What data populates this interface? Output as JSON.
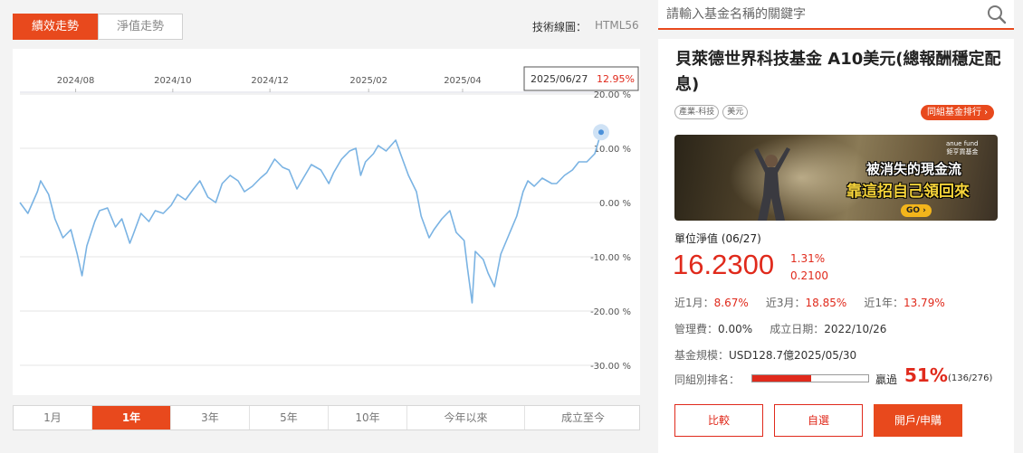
{
  "tabs": {
    "performance": "績效走勢",
    "nav": "淨值走勢"
  },
  "tech": {
    "label": "技術線圖：",
    "value": "HTML56"
  },
  "tooltip": {
    "date": "2025/06/27",
    "value": "12.95%"
  },
  "ranges": [
    "1月",
    "1年",
    "3年",
    "5年",
    "10年",
    "今年以來",
    "成立至今"
  ],
  "active_range": "1年",
  "search": {
    "placeholder": "請輸入基金名稱的關鍵字"
  },
  "fund": {
    "title": "貝萊德世界科技基金 A10美元(總報酬穩定配息)",
    "tags": [
      "產業-科技",
      "美元"
    ],
    "rank_button": "同組基金排行 ›",
    "banner": {
      "logo_line1": "anue fund",
      "logo_line2": "鉅亨買基金",
      "headline1": "被消失的現金流",
      "headline2": "靠這招自己領回來",
      "go": "GO ›"
    },
    "nav_label": "單位淨值 (06/27)",
    "nav_value": "16.2300",
    "nav_change_pct": "1.31%",
    "nav_change": "0.2100",
    "perf": {
      "m1_label": "近1月：",
      "m1_value": "8.67%",
      "m3_label": "近3月：",
      "m3_value": "18.85%",
      "y1_label": "近1年：",
      "y1_value": "13.79%"
    },
    "fee_label": "管理費：",
    "fee_value": "0.00%",
    "inception_label": "成立日期：",
    "inception_value": "2022/10/26",
    "size_label": "基金規模：",
    "size_value": "USD128.7億2025/05/30",
    "rank_label": "同組別排名：",
    "rank_fraction": 0.51,
    "win_label": "贏過",
    "win_pct": "51%",
    "win_count": "(136/276)",
    "buttons": {
      "compare": "比較",
      "watch": "自選",
      "open": "開戶/申購"
    }
  },
  "colors": {
    "accent": "#e8491d",
    "up": "#e02a1c",
    "line": "#7ab3e3"
  },
  "chart_data": {
    "type": "line",
    "x_ticks": [
      "2024/08",
      "2024/10",
      "2024/12",
      "2025/02",
      "2025/04"
    ],
    "y_ticks": [
      "20.00 %",
      "10.00 %",
      "0.00 %",
      "-10.00 %",
      "-20.00 %",
      "-30.00 %"
    ],
    "ylim": [
      -30,
      20
    ],
    "xlim": [
      "2024-06-27",
      "2025-06-27"
    ],
    "x_tick_dates": [
      "2024-08-01",
      "2024-10-01",
      "2024-12-01",
      "2025-02-01",
      "2025-04-01"
    ],
    "series": [
      {
        "dates": [
          "2024-06-27",
          "2024-07-02",
          "2024-07-08",
          "2024-07-10",
          "2024-07-15",
          "2024-07-19",
          "2024-07-24",
          "2024-07-29",
          "2024-08-02",
          "2024-08-05",
          "2024-08-08",
          "2024-08-13",
          "2024-08-16",
          "2024-08-21",
          "2024-08-26",
          "2024-08-30",
          "2024-09-04",
          "2024-09-06",
          "2024-09-11",
          "2024-09-16",
          "2024-09-20",
          "2024-09-25",
          "2024-09-30",
          "2024-10-04",
          "2024-10-09",
          "2024-10-14",
          "2024-10-18",
          "2024-10-23",
          "2024-10-28",
          "2024-11-01",
          "2024-11-06",
          "2024-11-11",
          "2024-11-15",
          "2024-11-20",
          "2024-11-25",
          "2024-11-29",
          "2024-12-04",
          "2024-12-09",
          "2024-12-13",
          "2024-12-18",
          "2024-12-23",
          "2024-12-27",
          "2025-01-02",
          "2025-01-07",
          "2025-01-10",
          "2025-01-15",
          "2025-01-20",
          "2025-01-24",
          "2025-01-27",
          "2025-01-30",
          "2025-02-04",
          "2025-02-07",
          "2025-02-12",
          "2025-02-18",
          "2025-02-21",
          "2025-02-26",
          "2025-03-03",
          "2025-03-06",
          "2025-03-11",
          "2025-03-14",
          "2025-03-19",
          "2025-03-24",
          "2025-03-28",
          "2025-04-02",
          "2025-04-04",
          "2025-04-07",
          "2025-04-09",
          "2025-04-14",
          "2025-04-17",
          "2025-04-21",
          "2025-04-25",
          "2025-04-30",
          "2025-05-05",
          "2025-05-09",
          "2025-05-12",
          "2025-05-16",
          "2025-05-21",
          "2025-05-27",
          "2025-05-30",
          "2025-06-04",
          "2025-06-09",
          "2025-06-13",
          "2025-06-18",
          "2025-06-23",
          "2025-06-27"
        ],
        "values": [
          0.0,
          -2.0,
          2.0,
          4.0,
          1.5,
          -3.0,
          -6.5,
          -5.0,
          -9.5,
          -13.5,
          -8.0,
          -3.5,
          -1.5,
          -1.0,
          -4.5,
          -3.0,
          -7.5,
          -6.0,
          -2.0,
          -3.5,
          -1.5,
          -2.0,
          -0.5,
          1.5,
          0.5,
          2.5,
          4.0,
          1.0,
          0.0,
          3.5,
          5.0,
          4.0,
          2.0,
          3.0,
          4.5,
          5.5,
          8.0,
          6.5,
          6.0,
          2.5,
          5.0,
          7.0,
          6.0,
          3.5,
          5.5,
          8.0,
          9.5,
          10.0,
          5.0,
          7.5,
          9.0,
          10.5,
          9.5,
          11.5,
          9.0,
          5.0,
          2.0,
          -2.5,
          -6.5,
          -5.0,
          -3.0,
          -1.5,
          -5.5,
          -7.0,
          -12.0,
          -18.5,
          -9.0,
          -10.5,
          -13.0,
          -15.5,
          -9.5,
          -6.0,
          -2.5,
          2.0,
          4.0,
          3.0,
          4.5,
          3.5,
          3.5,
          5.0,
          6.0,
          7.5,
          7.5,
          9.0,
          12.95
        ]
      }
    ]
  }
}
